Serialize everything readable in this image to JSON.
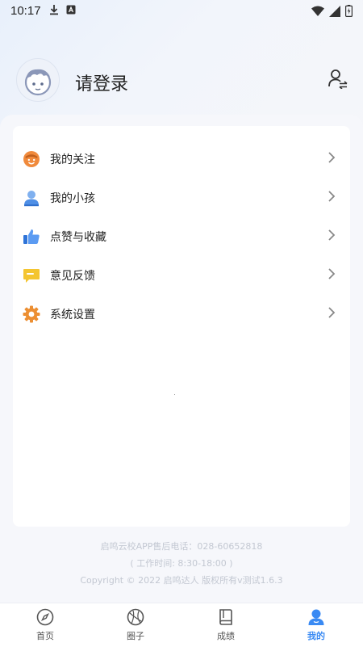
{
  "status_bar": {
    "time": "10:17"
  },
  "profile": {
    "login_text": "请登录"
  },
  "menu": {
    "items": [
      {
        "label": "我的关注",
        "icon": "smiley-face-icon",
        "color": "#f08a3c"
      },
      {
        "label": "我的小孩",
        "icon": "child-person-icon",
        "color": "#6aa6ee"
      },
      {
        "label": "点赞与收藏",
        "icon": "thumbs-up-icon",
        "color": "#4b8ef0"
      },
      {
        "label": "意见反馈",
        "icon": "feedback-chat-icon",
        "color": "#f4c530"
      },
      {
        "label": "系统设置",
        "icon": "gear-icon",
        "color": "#ec8f33"
      }
    ]
  },
  "footer": {
    "hotline": "启鸣云校APP售后电话：028-60652818",
    "hours": "( 工作时间: 8:30-18:00 )",
    "copyright": "Copyright © 2022 启鸣达人 版权所有v测试1.6.3"
  },
  "tabbar": {
    "active_color": "#3a8af3",
    "tabs": [
      {
        "label": "首页",
        "icon": "compass-icon"
      },
      {
        "label": "圈子",
        "icon": "circle-community-icon"
      },
      {
        "label": "成绩",
        "icon": "book-icon"
      },
      {
        "label": "我的",
        "icon": "user-profile-icon",
        "active": true
      }
    ]
  }
}
